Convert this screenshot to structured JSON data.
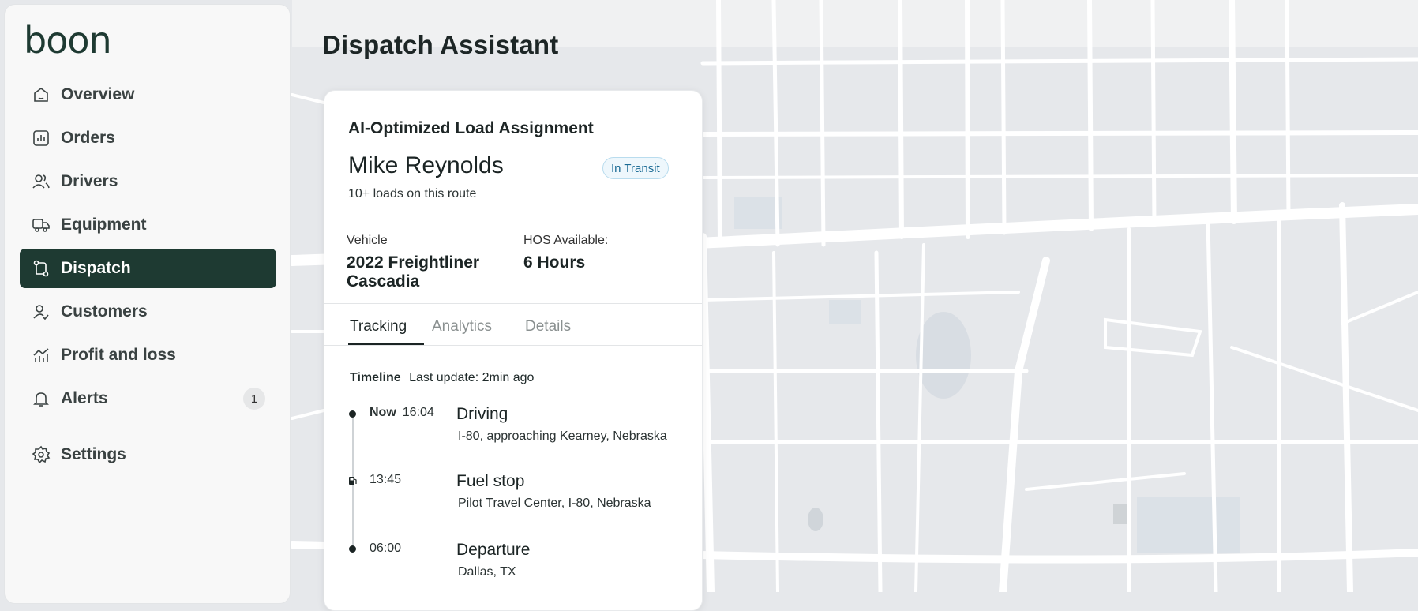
{
  "app": {
    "logo": "boon"
  },
  "sidebar": {
    "items": [
      {
        "label": "Overview",
        "icon": "home-icon"
      },
      {
        "label": "Orders",
        "icon": "chart-icon"
      },
      {
        "label": "Drivers",
        "icon": "users-icon"
      },
      {
        "label": "Equipment",
        "icon": "truck-icon"
      },
      {
        "label": "Dispatch",
        "icon": "route-icon",
        "active": true
      },
      {
        "label": "Customers",
        "icon": "user-check-icon"
      },
      {
        "label": "Profit and loss",
        "icon": "trend-icon"
      },
      {
        "label": "Alerts",
        "icon": "bell-icon",
        "badge": "1"
      }
    ],
    "settings": {
      "label": "Settings",
      "icon": "gear-icon"
    }
  },
  "header": {
    "title": "Dispatch Assistant"
  },
  "card": {
    "title": "AI-Optimized Load Assignment",
    "driver_name": "Mike Reynolds",
    "status": "In Transit",
    "driver_sub": "10+ loads on this route",
    "vehicle_label": "Vehicle",
    "vehicle_value_line1": "2022 Freightliner",
    "vehicle_value_line2": "Cascadia",
    "hos_label": "HOS Available:",
    "hos_value": "6 Hours",
    "tabs": [
      "Tracking",
      "Analytics",
      "Details"
    ],
    "timeline": {
      "label": "Timeline",
      "update": "Last update: 2min ago",
      "events": [
        {
          "now": "Now",
          "time": "16:04",
          "title": "Driving",
          "sub": "I-80, approaching Kearney, Nebraska",
          "marker": "dot"
        },
        {
          "now": "",
          "time": "13:45",
          "title": "Fuel stop",
          "sub": "Pilot Travel Center, I-80, Nebraska",
          "marker": "fuel-icon"
        },
        {
          "now": "",
          "time": "06:00",
          "title": "Departure",
          "sub": "Dallas, TX",
          "marker": "dot"
        }
      ]
    }
  },
  "colors": {
    "accent": "#1e3a32",
    "badge_text": "#1b6b95",
    "map_road": "#ffffff",
    "map_bg": "#e6e8eb"
  }
}
